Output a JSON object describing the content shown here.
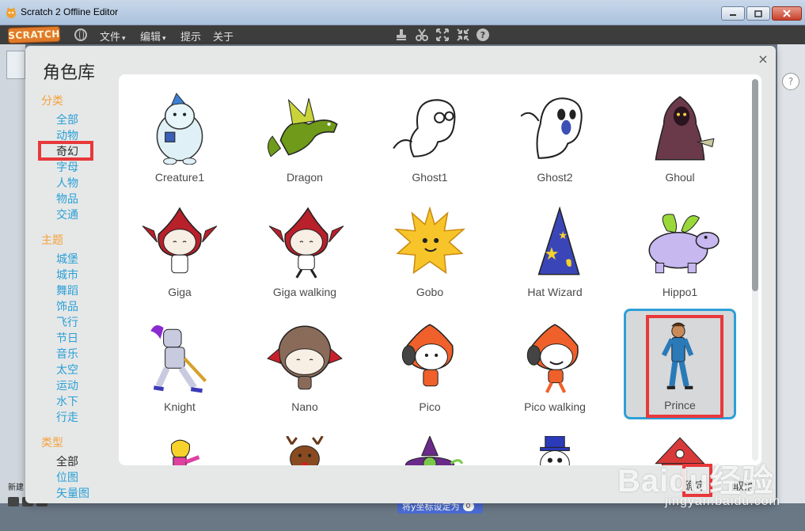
{
  "window": {
    "title": "Scratch 2 Offline Editor",
    "controls": {
      "minimize": "—",
      "maximize": "☐",
      "close": "✕"
    }
  },
  "menubar": {
    "logo": "SCRATCH",
    "items": [
      {
        "label": "文件",
        "caret": "▾"
      },
      {
        "label": "编辑",
        "caret": "▾"
      },
      {
        "label": "提示"
      },
      {
        "label": "关于"
      }
    ],
    "tool_icons": [
      "stamp-icon",
      "scissors-icon",
      "grow-icon",
      "shrink-icon",
      "help-icon"
    ]
  },
  "background": {
    "stage_hint": "v4",
    "new_label": "新建",
    "block_text": "将y坐标设定为",
    "block_value": "0",
    "help_glyph": "?"
  },
  "dialog": {
    "title": "角色库",
    "close_glyph": "×",
    "sidebar": {
      "sections": [
        {
          "heading": "分类",
          "items": [
            "全部",
            "动物",
            "奇幻",
            "字母",
            "人物",
            "物品",
            "交通"
          ],
          "selected": "奇幻"
        },
        {
          "heading": "主题",
          "items": [
            "城堡",
            "城市",
            "舞蹈",
            "饰品",
            "飞行",
            "节日",
            "音乐",
            "太空",
            "运动",
            "水下",
            "行走"
          ]
        },
        {
          "heading": "类型",
          "items": [
            "全部",
            "位图",
            "矢量图"
          ],
          "selected": "全部"
        }
      ]
    },
    "sprites": [
      {
        "name": "Creature1",
        "icon": "creature-icon"
      },
      {
        "name": "Dragon",
        "icon": "dragon-icon"
      },
      {
        "name": "Ghost1",
        "icon": "ghost-icon"
      },
      {
        "name": "Ghost2",
        "icon": "ghost-icon"
      },
      {
        "name": "Ghoul",
        "icon": "ghoul-icon"
      },
      {
        "name": "Giga",
        "icon": "giga-icon"
      },
      {
        "name": "Giga walking",
        "icon": "giga-icon"
      },
      {
        "name": "Gobo",
        "icon": "gobo-icon"
      },
      {
        "name": "Hat Wizard",
        "icon": "wizard-hat-icon"
      },
      {
        "name": "Hippo1",
        "icon": "hippo-icon"
      },
      {
        "name": "Knight",
        "icon": "knight-icon"
      },
      {
        "name": "Nano",
        "icon": "nano-icon"
      },
      {
        "name": "Pico",
        "icon": "pico-icon"
      },
      {
        "name": "Pico walking",
        "icon": "pico-icon"
      },
      {
        "name": "Prince",
        "icon": "prince-icon",
        "selected": true
      },
      {
        "name": "",
        "icon": "princess-icon"
      },
      {
        "name": "",
        "icon": "reindeer-icon"
      },
      {
        "name": "",
        "icon": "witch-icon"
      },
      {
        "name": "",
        "icon": "penguin-icon"
      },
      {
        "name": "",
        "icon": "house-icon"
      }
    ],
    "footer": {
      "ok": "确定",
      "cancel": "取消"
    }
  },
  "watermark": {
    "brand": "Baidu经验",
    "url": "jingyan.baidu.com"
  },
  "colors": {
    "heading": "#f4a23a",
    "link": "#2a9fd6",
    "selection_border": "#2d9fd8",
    "annotation_red": "#e8383a"
  }
}
